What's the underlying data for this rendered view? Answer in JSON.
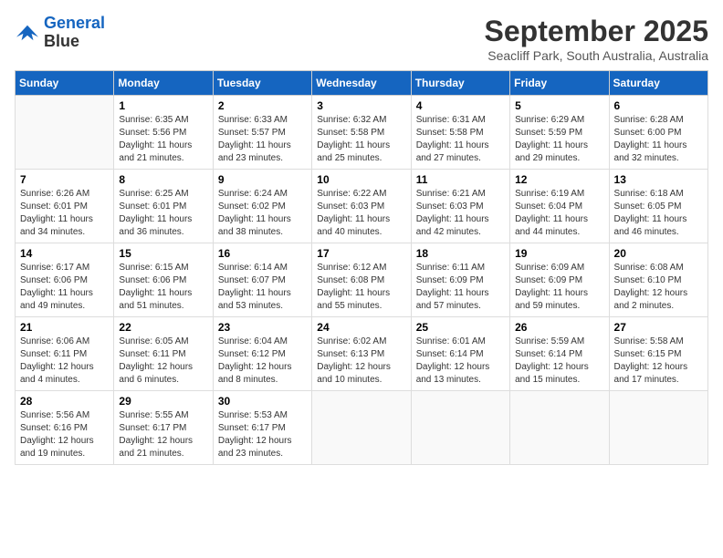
{
  "logo": {
    "line1": "General",
    "line2": "Blue"
  },
  "title": "September 2025",
  "subtitle": "Seacliff Park, South Australia, Australia",
  "days_of_week": [
    "Sunday",
    "Monday",
    "Tuesday",
    "Wednesday",
    "Thursday",
    "Friday",
    "Saturday"
  ],
  "weeks": [
    [
      {
        "day": "",
        "info": ""
      },
      {
        "day": "1",
        "info": "Sunrise: 6:35 AM\nSunset: 5:56 PM\nDaylight: 11 hours\nand 21 minutes."
      },
      {
        "day": "2",
        "info": "Sunrise: 6:33 AM\nSunset: 5:57 PM\nDaylight: 11 hours\nand 23 minutes."
      },
      {
        "day": "3",
        "info": "Sunrise: 6:32 AM\nSunset: 5:58 PM\nDaylight: 11 hours\nand 25 minutes."
      },
      {
        "day": "4",
        "info": "Sunrise: 6:31 AM\nSunset: 5:58 PM\nDaylight: 11 hours\nand 27 minutes."
      },
      {
        "day": "5",
        "info": "Sunrise: 6:29 AM\nSunset: 5:59 PM\nDaylight: 11 hours\nand 29 minutes."
      },
      {
        "day": "6",
        "info": "Sunrise: 6:28 AM\nSunset: 6:00 PM\nDaylight: 11 hours\nand 32 minutes."
      }
    ],
    [
      {
        "day": "7",
        "info": "Sunrise: 6:26 AM\nSunset: 6:01 PM\nDaylight: 11 hours\nand 34 minutes."
      },
      {
        "day": "8",
        "info": "Sunrise: 6:25 AM\nSunset: 6:01 PM\nDaylight: 11 hours\nand 36 minutes."
      },
      {
        "day": "9",
        "info": "Sunrise: 6:24 AM\nSunset: 6:02 PM\nDaylight: 11 hours\nand 38 minutes."
      },
      {
        "day": "10",
        "info": "Sunrise: 6:22 AM\nSunset: 6:03 PM\nDaylight: 11 hours\nand 40 minutes."
      },
      {
        "day": "11",
        "info": "Sunrise: 6:21 AM\nSunset: 6:03 PM\nDaylight: 11 hours\nand 42 minutes."
      },
      {
        "day": "12",
        "info": "Sunrise: 6:19 AM\nSunset: 6:04 PM\nDaylight: 11 hours\nand 44 minutes."
      },
      {
        "day": "13",
        "info": "Sunrise: 6:18 AM\nSunset: 6:05 PM\nDaylight: 11 hours\nand 46 minutes."
      }
    ],
    [
      {
        "day": "14",
        "info": "Sunrise: 6:17 AM\nSunset: 6:06 PM\nDaylight: 11 hours\nand 49 minutes."
      },
      {
        "day": "15",
        "info": "Sunrise: 6:15 AM\nSunset: 6:06 PM\nDaylight: 11 hours\nand 51 minutes."
      },
      {
        "day": "16",
        "info": "Sunrise: 6:14 AM\nSunset: 6:07 PM\nDaylight: 11 hours\nand 53 minutes."
      },
      {
        "day": "17",
        "info": "Sunrise: 6:12 AM\nSunset: 6:08 PM\nDaylight: 11 hours\nand 55 minutes."
      },
      {
        "day": "18",
        "info": "Sunrise: 6:11 AM\nSunset: 6:09 PM\nDaylight: 11 hours\nand 57 minutes."
      },
      {
        "day": "19",
        "info": "Sunrise: 6:09 AM\nSunset: 6:09 PM\nDaylight: 11 hours\nand 59 minutes."
      },
      {
        "day": "20",
        "info": "Sunrise: 6:08 AM\nSunset: 6:10 PM\nDaylight: 12 hours\nand 2 minutes."
      }
    ],
    [
      {
        "day": "21",
        "info": "Sunrise: 6:06 AM\nSunset: 6:11 PM\nDaylight: 12 hours\nand 4 minutes."
      },
      {
        "day": "22",
        "info": "Sunrise: 6:05 AM\nSunset: 6:11 PM\nDaylight: 12 hours\nand 6 minutes."
      },
      {
        "day": "23",
        "info": "Sunrise: 6:04 AM\nSunset: 6:12 PM\nDaylight: 12 hours\nand 8 minutes."
      },
      {
        "day": "24",
        "info": "Sunrise: 6:02 AM\nSunset: 6:13 PM\nDaylight: 12 hours\nand 10 minutes."
      },
      {
        "day": "25",
        "info": "Sunrise: 6:01 AM\nSunset: 6:14 PM\nDaylight: 12 hours\nand 13 minutes."
      },
      {
        "day": "26",
        "info": "Sunrise: 5:59 AM\nSunset: 6:14 PM\nDaylight: 12 hours\nand 15 minutes."
      },
      {
        "day": "27",
        "info": "Sunrise: 5:58 AM\nSunset: 6:15 PM\nDaylight: 12 hours\nand 17 minutes."
      }
    ],
    [
      {
        "day": "28",
        "info": "Sunrise: 5:56 AM\nSunset: 6:16 PM\nDaylight: 12 hours\nand 19 minutes."
      },
      {
        "day": "29",
        "info": "Sunrise: 5:55 AM\nSunset: 6:17 PM\nDaylight: 12 hours\nand 21 minutes."
      },
      {
        "day": "30",
        "info": "Sunrise: 5:53 AM\nSunset: 6:17 PM\nDaylight: 12 hours\nand 23 minutes."
      },
      {
        "day": "",
        "info": ""
      },
      {
        "day": "",
        "info": ""
      },
      {
        "day": "",
        "info": ""
      },
      {
        "day": "",
        "info": ""
      }
    ]
  ]
}
